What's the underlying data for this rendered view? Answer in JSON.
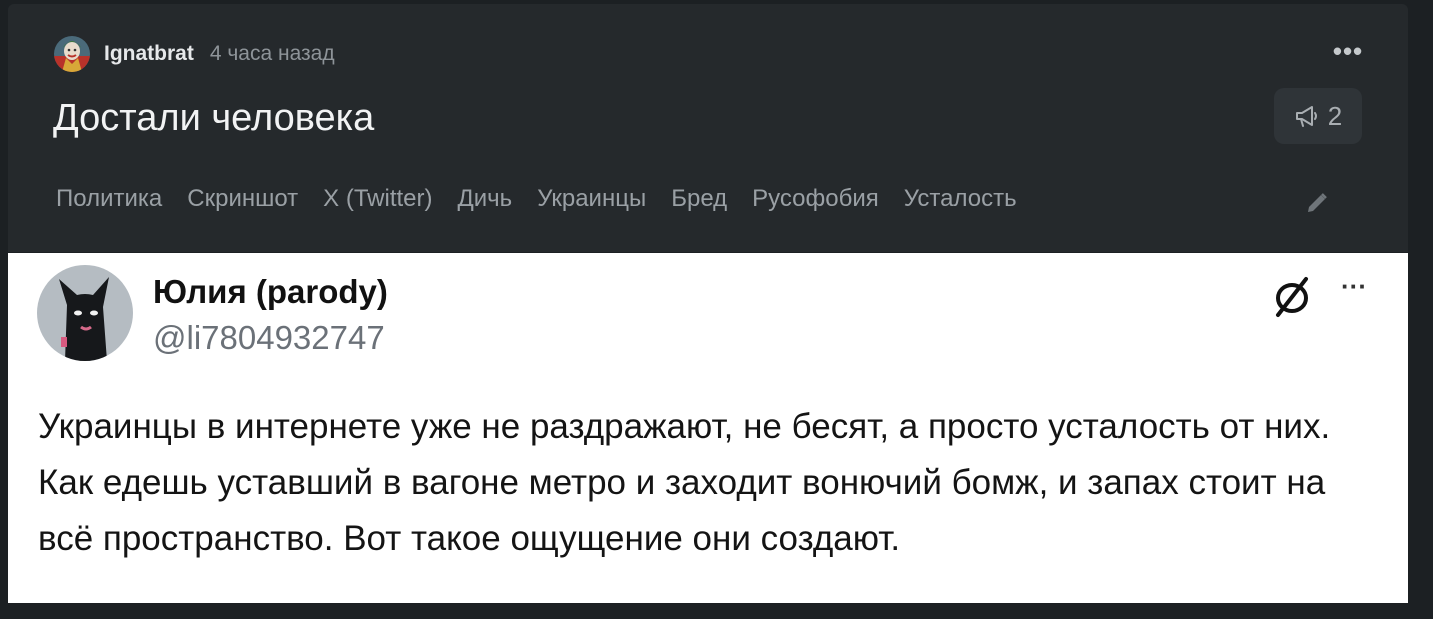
{
  "post": {
    "author": "Ignatbrat",
    "time": "4 часа назад",
    "title": "Достали человека",
    "comments_count": "2",
    "more_label": "•••",
    "tags": [
      "Политика",
      "Скриншот",
      "X (Twitter)",
      "Дичь",
      "Украинцы",
      "Бред",
      "Русофобия",
      "Усталость"
    ]
  },
  "tweet": {
    "name": "Юлия (parody)",
    "handle": "@li7804932747",
    "more_label": "···",
    "text": "Украинцы в интернете уже не раздражают, не бесят, а просто усталость от них. Как едешь уставший в вагоне метро и заходит вонючий бомж, и запах стоит на всё пространство. Вот такое ощущение они создают."
  },
  "colors": {
    "page_bg": "#1c2023",
    "card_bg": "#25292c",
    "button_bg": "#2f3438",
    "tag_text": "#9aa0a5"
  },
  "icons": {
    "avatar": "joker-avatar",
    "comments": "megaphone-icon",
    "edit": "pencil-icon",
    "tweet_logo": "crossed-circle-icon"
  }
}
